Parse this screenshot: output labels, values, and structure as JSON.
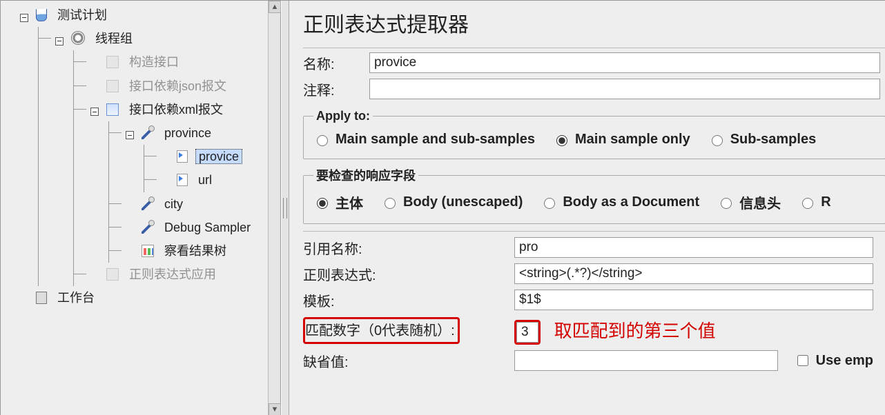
{
  "tree": {
    "root": "测试计划",
    "thread_group": "线程组",
    "items": [
      "构造接口",
      "接口依赖json报文"
    ],
    "xml_group": "接口依赖xml报文",
    "province": "province",
    "provice_child": "provice",
    "url_child": "url",
    "city": "city",
    "debug": "Debug Sampler",
    "view_tree": "察看结果树",
    "regex_app": "正则表达式应用",
    "workbench": "工作台"
  },
  "panel": {
    "title": "正则表达式提取器",
    "name_label": "名称:",
    "name_value": "provice",
    "comment_label": "注释:",
    "comment_value": ""
  },
  "apply_to": {
    "legend": "Apply to:",
    "options": [
      "Main sample and sub-samples",
      "Main sample only",
      "Sub-samples"
    ],
    "selected_index": 1
  },
  "response_field": {
    "legend": "要检查的响应字段",
    "options": [
      "主体",
      "Body (unescaped)",
      "Body as a Document",
      "信息头",
      "R"
    ],
    "selected_index": 0
  },
  "props": {
    "ref_label": "引用名称:",
    "ref_value": "pro",
    "regex_label": "正则表达式:",
    "regex_value": "<string>(.*?)</string>",
    "template_label": "模板:",
    "template_value": "$1$",
    "match_label": "匹配数字（0代表随机）:",
    "match_value": "3",
    "default_label": "缺省值:",
    "default_value": "",
    "use_empty": "Use emp"
  },
  "annotation": "取匹配到的第三个值"
}
